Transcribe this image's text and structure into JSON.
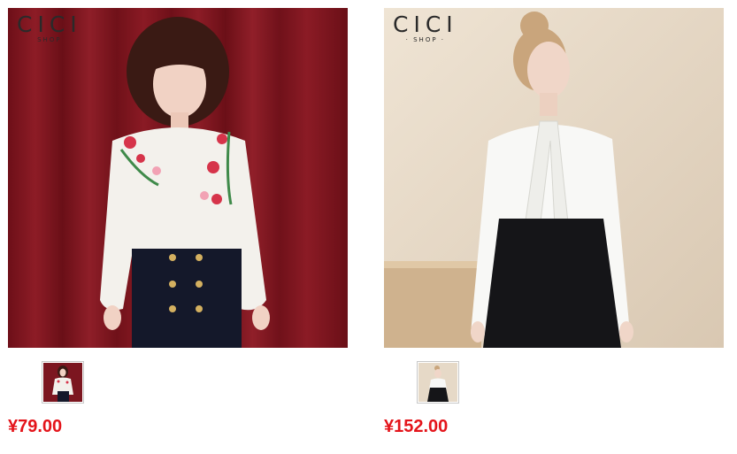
{
  "products": [
    {
      "brand": "CICI",
      "brand_sub": "SHOP",
      "price": "¥79.00"
    },
    {
      "brand": "CICI",
      "brand_sub": "· SHOP ·",
      "price": "¥152.00"
    }
  ],
  "colors": {
    "price": "#e4141a",
    "curtain": "#7c1620",
    "backdrop": "#e6d9c7"
  }
}
